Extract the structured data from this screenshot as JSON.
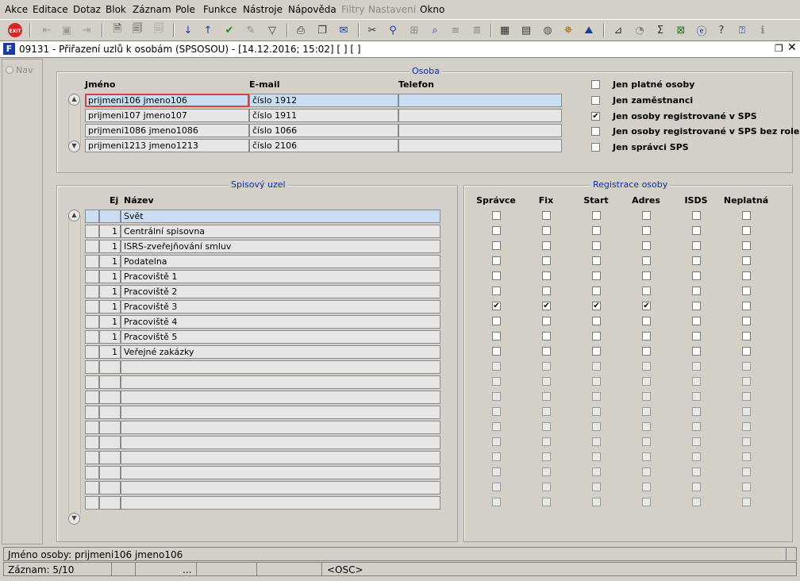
{
  "menu": [
    "Akce",
    "Editace",
    "Dotaz",
    "Blok",
    "Záznam",
    "Pole",
    "Funkce",
    "Nástroje",
    "Nápověda",
    "Filtry",
    "Nastavení",
    "Okno"
  ],
  "menu_disabled": [
    "Filtry",
    "Nastavení"
  ],
  "window": {
    "title": "09131 - Přiřazení uzlů k osobám (SPSOSOU) - [14.12.2016; 15:02]  [ ]  [ ]"
  },
  "nav": {
    "label": "Nav"
  },
  "osoba": {
    "frame_title": "Osoba",
    "headers": {
      "name": "Jméno",
      "email": "E-mail",
      "phone": "Telefon"
    },
    "rows": [
      {
        "name": "prijmeni106 jmeno106",
        "email": "číslo 1912",
        "phone": ""
      },
      {
        "name": "prijmeni107 jmeno107",
        "email": "číslo 1911",
        "phone": ""
      },
      {
        "name": "prijmeni1086 jmeno1086",
        "email": "číslo 1066",
        "phone": ""
      },
      {
        "name": "prijmeni1213 jmeno1213",
        "email": "číslo 2106",
        "phone": ""
      }
    ],
    "filters": [
      {
        "label": "Jen platné osoby",
        "checked": false
      },
      {
        "label": "Jen zaměstnanci",
        "checked": false
      },
      {
        "label": "Jen osoby registrované v SPS",
        "checked": true
      },
      {
        "label": "Jen osoby registrované v SPS bez role",
        "checked": false
      },
      {
        "label": "Jen správci SPS",
        "checked": false
      }
    ]
  },
  "uzel": {
    "frame_title": "Spisový uzel",
    "headers": {
      "ej": "Ej",
      "name": "Název"
    },
    "rows": [
      {
        "ej": "",
        "name": "Svět"
      },
      {
        "ej": "1",
        "name": "Centrální spisovna"
      },
      {
        "ej": "1",
        "name": "ISRS-zveřejňování smluv"
      },
      {
        "ej": "1",
        "name": "Podatelna"
      },
      {
        "ej": "1",
        "name": "Pracoviště 1"
      },
      {
        "ej": "1",
        "name": "Pracoviště 2"
      },
      {
        "ej": "1",
        "name": "Pracoviště 3"
      },
      {
        "ej": "1",
        "name": "Pracoviště 4"
      },
      {
        "ej": "1",
        "name": "Pracoviště 5"
      },
      {
        "ej": "1",
        "name": "Veřejné zakázky"
      },
      {
        "ej": "",
        "name": ""
      },
      {
        "ej": "",
        "name": ""
      },
      {
        "ej": "",
        "name": ""
      },
      {
        "ej": "",
        "name": ""
      },
      {
        "ej": "",
        "name": ""
      },
      {
        "ej": "",
        "name": ""
      },
      {
        "ej": "",
        "name": ""
      },
      {
        "ej": "",
        "name": ""
      },
      {
        "ej": "",
        "name": ""
      },
      {
        "ej": "",
        "name": ""
      }
    ]
  },
  "registrace": {
    "frame_title": "Registrace osoby",
    "columns": [
      "Správce",
      "Fix",
      "Start",
      "Adres",
      "ISDS",
      "Neplatná"
    ],
    "checked_row": 6,
    "checked_cols": [
      0,
      1,
      2,
      3
    ],
    "active_rows": 10
  },
  "status": {
    "line1": "Jméno osoby: prijmeni106 jmeno106",
    "record": "Záznam: 5/10",
    "dots": "...",
    "mode": "<OSC>"
  }
}
